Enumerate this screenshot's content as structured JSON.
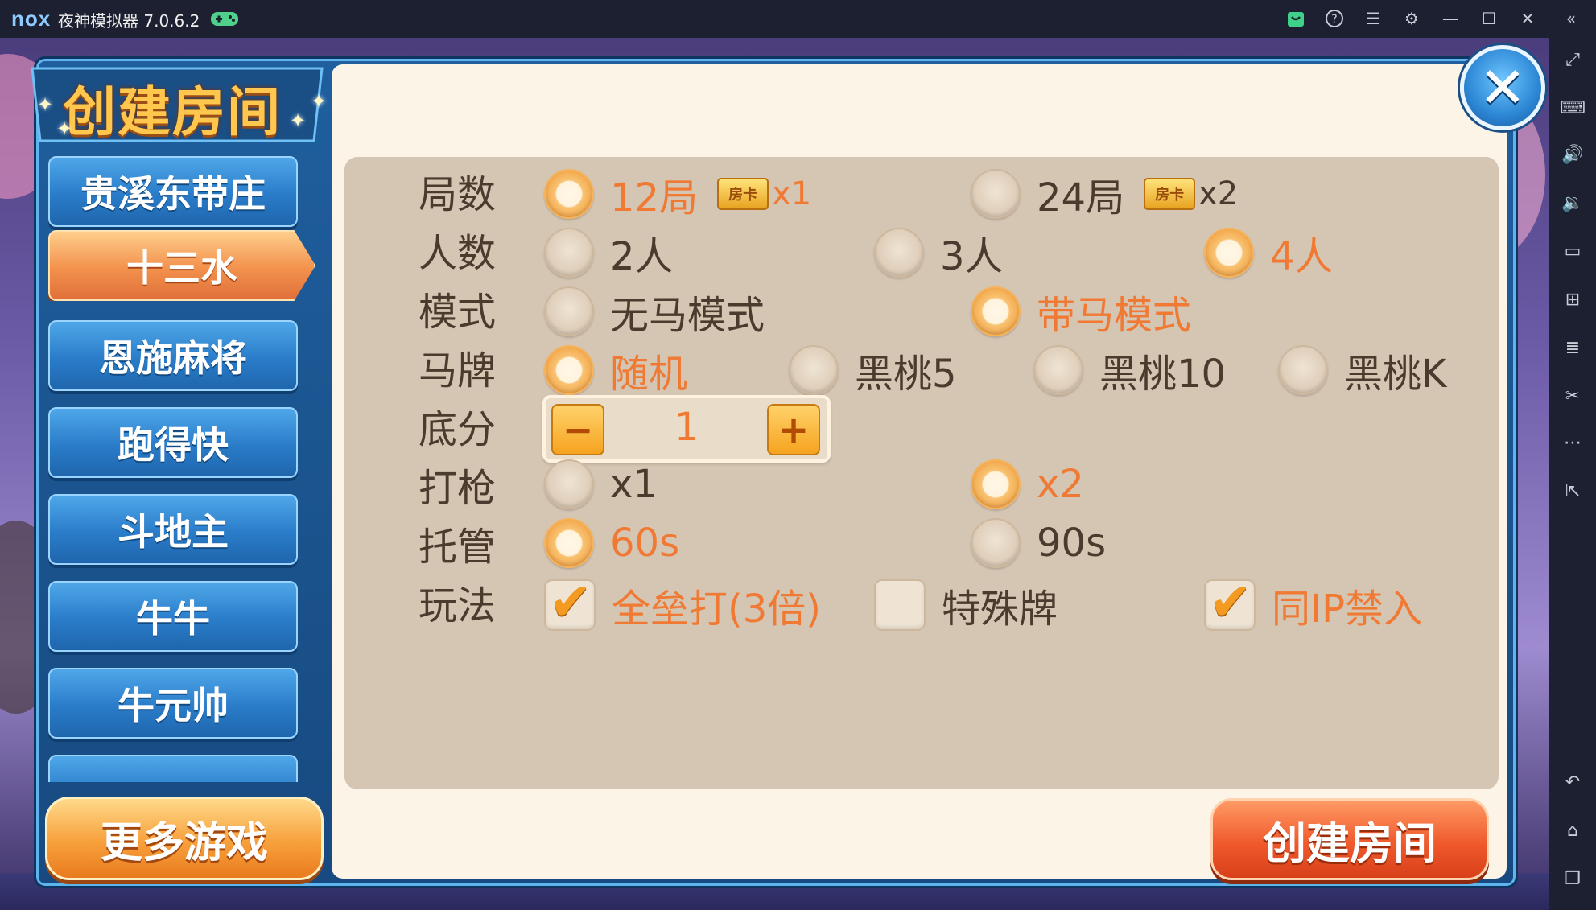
{
  "window": {
    "logo": "nox",
    "title": "夜神模拟器 7.0.6.2",
    "title_icons": [
      "gamepad-icon",
      "store-icon",
      "help-icon",
      "menu-icon",
      "settings-icon",
      "minimize-icon",
      "maximize-icon",
      "close-icon",
      "collapse-icon"
    ]
  },
  "dialog": {
    "title": "创建房间",
    "close_label": "✕"
  },
  "menu": {
    "items": [
      {
        "label": "贵溪东带庄"
      },
      {
        "label": "十三水",
        "active": true
      },
      {
        "label": "恩施麻将"
      },
      {
        "label": "跑得快"
      },
      {
        "label": "斗地主"
      },
      {
        "label": "牛牛"
      },
      {
        "label": "牛元帅"
      }
    ],
    "more_games": "更多游戏"
  },
  "settings": {
    "rounds": {
      "label": "局数",
      "options": [
        {
          "text": "12局",
          "card": "房卡",
          "mult": "x1",
          "selected": true
        },
        {
          "text": "24局",
          "card": "房卡",
          "mult": "x2",
          "selected": false
        }
      ]
    },
    "players": {
      "label": "人数",
      "options": [
        {
          "text": "2人",
          "selected": false
        },
        {
          "text": "3人",
          "selected": false
        },
        {
          "text": "4人",
          "selected": true
        }
      ]
    },
    "mode": {
      "label": "模式",
      "options": [
        {
          "text": "无马模式",
          "selected": false
        },
        {
          "text": "带马模式",
          "selected": true
        }
      ]
    },
    "horse": {
      "label": "马牌",
      "options": [
        {
          "text": "随机",
          "selected": true
        },
        {
          "text": "黑桃5",
          "selected": false
        },
        {
          "text": "黑桃10",
          "selected": false
        },
        {
          "text": "黑桃K",
          "selected": false
        }
      ]
    },
    "base": {
      "label": "底分",
      "value": "1",
      "minus": "−",
      "plus": "+"
    },
    "gun": {
      "label": "打枪",
      "options": [
        {
          "text": "x1",
          "selected": false
        },
        {
          "text": "x2",
          "selected": true
        }
      ]
    },
    "auto": {
      "label": "托管",
      "options": [
        {
          "text": "60s",
          "selected": true
        },
        {
          "text": "90s",
          "selected": false
        }
      ]
    },
    "rules": {
      "label": "玩法",
      "options": [
        {
          "text": "全垒打(3倍)",
          "checked": true
        },
        {
          "text": "特殊牌",
          "checked": false
        },
        {
          "text": "同IP禁入",
          "checked": true
        }
      ]
    }
  },
  "create_button": "创建房间",
  "colors": {
    "selected_text": "#f07a34",
    "normal_text": "#4a3b2e",
    "panel": "#d5c5b3",
    "dialog_blue": "#1f5f9e"
  },
  "sidebar_icons": [
    "fullscreen-icon",
    "keyboard-icon",
    "volume-up-icon",
    "volume-down-icon",
    "screen-icon",
    "apk-install-icon",
    "layers-icon",
    "scissors-icon",
    "more-icon",
    "external-icon",
    "back-icon",
    "home-icon",
    "recent-apps-icon"
  ]
}
